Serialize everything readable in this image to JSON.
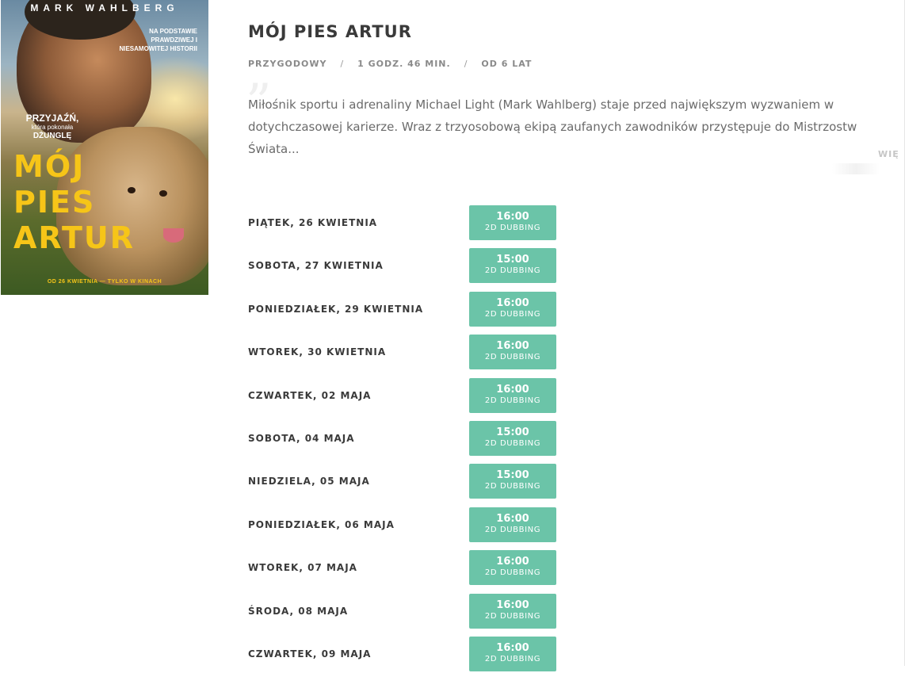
{
  "poster": {
    "actor": "MARK WAHLBERG",
    "tagline": "NA PODSTAWIE PRAWDZIWEJ I NIESAMOWITEJ HISTORII",
    "friend_l1": "PRZYJAŹŃ,",
    "friend_l2": "która pokonała",
    "friend_l3": "DŻUNGLĘ",
    "title_line1": "MÓJ",
    "title_line2": "PIES",
    "title_line3": "ARTUR",
    "release": "OD 26 KWIETNIA — TYLKO W KINACH"
  },
  "movie": {
    "title": "MÓJ PIES ARTUR",
    "genre": "PRZYGODOWY",
    "duration": "1 GODZ. 46 MIN.",
    "age": "OD 6 LAT",
    "separator": "/",
    "description": "Miłośnik sportu i adrenaliny Michael Light (Mark Wahlberg) staje przed największym wyzwaniem w dotychczasowej karierze. Wraz z trzyosobową ekipą zaufanych zawodników przystępuje do Mistrzostw Świata...",
    "more_label": "WIĘ"
  },
  "showtimes": [
    {
      "day": "PIĄTEK, 26 KWIETNIA",
      "time": "16:00",
      "format": "2D DUBBING"
    },
    {
      "day": "SOBOTA, 27 KWIETNIA",
      "time": "15:00",
      "format": "2D DUBBING"
    },
    {
      "day": "PONIEDZIAŁEK, 29 KWIETNIA",
      "time": "16:00",
      "format": "2D DUBBING"
    },
    {
      "day": "WTOREK, 30 KWIETNIA",
      "time": "16:00",
      "format": "2D DUBBING"
    },
    {
      "day": "CZWARTEK, 02 MAJA",
      "time": "16:00",
      "format": "2D DUBBING"
    },
    {
      "day": "SOBOTA, 04 MAJA",
      "time": "15:00",
      "format": "2D DUBBING"
    },
    {
      "day": "NIEDZIELA, 05 MAJA",
      "time": "15:00",
      "format": "2D DUBBING"
    },
    {
      "day": "PONIEDZIAŁEK, 06 MAJA",
      "time": "16:00",
      "format": "2D DUBBING"
    },
    {
      "day": "WTOREK, 07 MAJA",
      "time": "16:00",
      "format": "2D DUBBING"
    },
    {
      "day": "ŚRODA, 08 MAJA",
      "time": "16:00",
      "format": "2D DUBBING"
    },
    {
      "day": "CZWARTEK, 09 MAJA",
      "time": "16:00",
      "format": "2D DUBBING"
    }
  ],
  "colors": {
    "button": "#6bc4a8",
    "poster_title": "#f6c518"
  }
}
